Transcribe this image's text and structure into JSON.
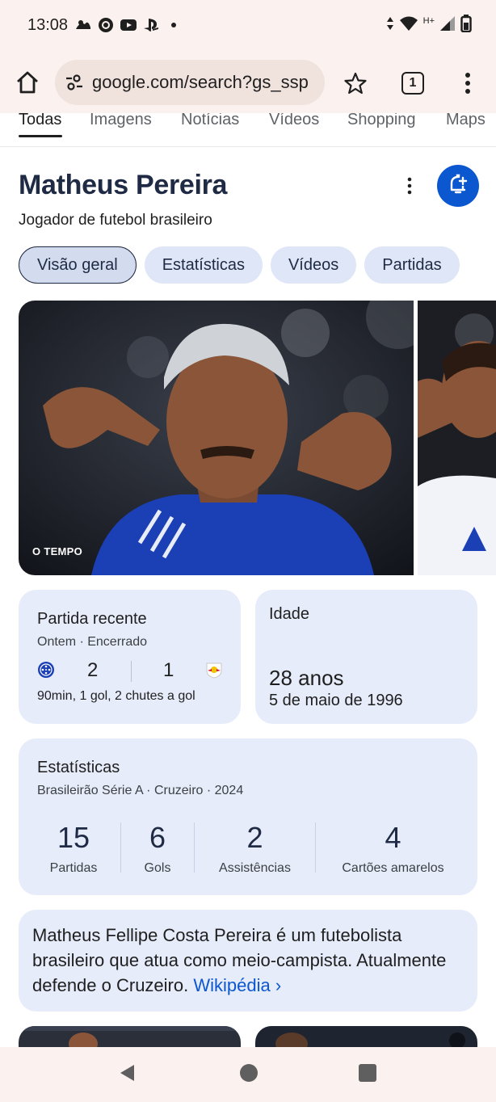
{
  "status_bar": {
    "time": "13:08",
    "left_icons": [
      "steam-icon",
      "android-icon",
      "youtube-icon",
      "playstation-icon",
      "dot-icon"
    ],
    "right_icons": [
      "data-arrows-icon",
      "wifi-icon",
      "network-type-icon",
      "signal-icon",
      "battery-icon"
    ],
    "network_type": "H+"
  },
  "browser": {
    "url": "google.com/search?gs_ssp",
    "tab_count": "1"
  },
  "search_tabs": [
    "Todas",
    "Imagens",
    "Notícias",
    "Vídeos",
    "Shopping",
    "Maps"
  ],
  "knowledge_panel": {
    "title": "Matheus Pereira",
    "subtitle": "Jogador de futebol brasileiro",
    "chips": [
      "Visão geral",
      "Estatísticas",
      "Vídeos",
      "Partidas"
    ],
    "image_source": "O TEMPO"
  },
  "recent_match": {
    "heading": "Partida recente",
    "status": "Ontem · Encerrado",
    "home_score": "2",
    "away_score": "1",
    "summary": "90min, 1 gol, 2 chutes a gol"
  },
  "age": {
    "heading": "Idade",
    "value": "28 anos",
    "birth_date": "5 de maio de 1996"
  },
  "stats": {
    "heading": "Estatísticas",
    "context": "Brasileirão Série A · Cruzeiro · 2024",
    "items": [
      {
        "value": "15",
        "label": "Partidas"
      },
      {
        "value": "6",
        "label": "Gols"
      },
      {
        "value": "2",
        "label": "Assistências"
      },
      {
        "value": "4",
        "label": "Cartões amarelos"
      }
    ]
  },
  "about": {
    "text": "Matheus Fellipe Costa Pereira é um futebolista brasileiro que atua como meio-campista. Atualmente defende o Cruzeiro.",
    "link": "Wikipédia ›"
  },
  "colors": {
    "accent": "#0b57d0",
    "card_bg": "#e6ecfa",
    "chrome_bg": "#fbf1ee",
    "title": "#1f2a44"
  }
}
